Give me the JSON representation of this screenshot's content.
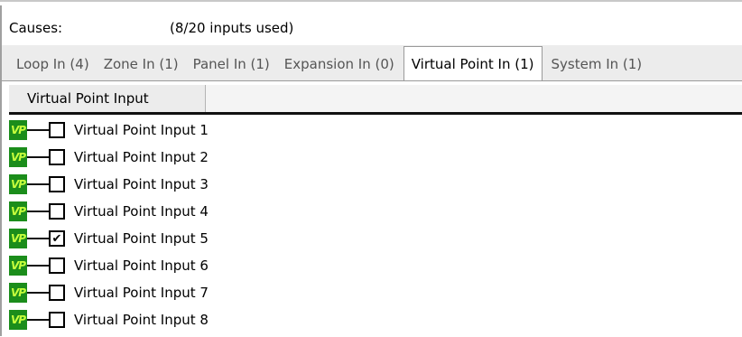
{
  "causes": {
    "label": "Causes:",
    "usage": "(8/20 inputs used)"
  },
  "tabs": [
    {
      "label": "Loop In (4)",
      "active": false
    },
    {
      "label": "Zone In (1)",
      "active": false
    },
    {
      "label": "Panel In (1)",
      "active": false
    },
    {
      "label": "Expansion In (0)",
      "active": false
    },
    {
      "label": "Virtual Point In (1)",
      "active": true
    },
    {
      "label": "System In (1)",
      "active": false
    }
  ],
  "column_header": "Virtual Point Input",
  "icon_text": "VP",
  "icon": "vp-badge-icon",
  "colors": {
    "icon_bg": "#1b8d1b",
    "icon_fg": "#c6ff3c"
  },
  "rows": [
    {
      "label": "Virtual Point Input 1",
      "checked": false
    },
    {
      "label": "Virtual Point Input 2",
      "checked": false
    },
    {
      "label": "Virtual Point Input 3",
      "checked": false
    },
    {
      "label": "Virtual Point Input 4",
      "checked": false
    },
    {
      "label": "Virtual Point Input 5",
      "checked": true
    },
    {
      "label": "Virtual Point Input 6",
      "checked": false
    },
    {
      "label": "Virtual Point Input 7",
      "checked": false
    },
    {
      "label": "Virtual Point Input 8",
      "checked": false
    }
  ]
}
